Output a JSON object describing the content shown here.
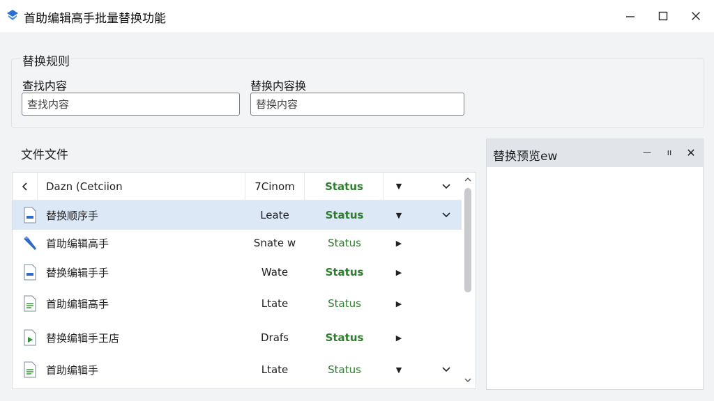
{
  "window": {
    "title": "首助编辑高手批量替换功能",
    "icon": "app-logo-icon",
    "controls": [
      "minimize-icon",
      "maximize-icon",
      "close-icon"
    ]
  },
  "rules": {
    "legend": "替换规则",
    "find_label": "查找内容",
    "find_placeholder": "查找内容",
    "replace_label": "替换内容换",
    "replace_placeholder": "替换内容"
  },
  "files": {
    "title": "文件文件",
    "columns": {
      "back_icon": "chevron-left-icon",
      "name": "Dazn (Cetciion",
      "size": "7Cinom",
      "status": "Status"
    },
    "rows": [
      {
        "name": "替换顺序手",
        "size": "Leate",
        "status": "Status",
        "icon": "document-icon",
        "selected": true,
        "chevron": true
      },
      {
        "name": "首助编辑高手",
        "size": "Snate w",
        "status": "Status",
        "icon": "pen-icon",
        "selected": false,
        "chevron": false
      },
      {
        "name": "替换编辑手手",
        "size": "Wate",
        "status": "Status",
        "icon": "document-icon",
        "selected": false,
        "chevron": false
      },
      {
        "name": "首助编辑高手",
        "size": "Ltate",
        "status": "Status",
        "icon": "spreadsheet-icon",
        "selected": false,
        "chevron": false
      },
      {
        "name": "替换编辑手王店",
        "size": "Drafs",
        "status": "Status",
        "icon": "document-play-icon",
        "selected": false,
        "chevron": false
      },
      {
        "name": "首助编辑手",
        "size": "Ltate",
        "status": "Status",
        "icon": "spreadsheet-icon",
        "selected": false,
        "chevron": true
      }
    ]
  },
  "preview": {
    "title": "替换预览ew",
    "min_label": "—",
    "restore_label": "ıı",
    "close_label": "✕"
  },
  "colors": {
    "accent_border": "#5b84c8",
    "status_green": "#2e7d2e",
    "selection": "#dde8f7",
    "preview_header": "#e1e5ea"
  }
}
